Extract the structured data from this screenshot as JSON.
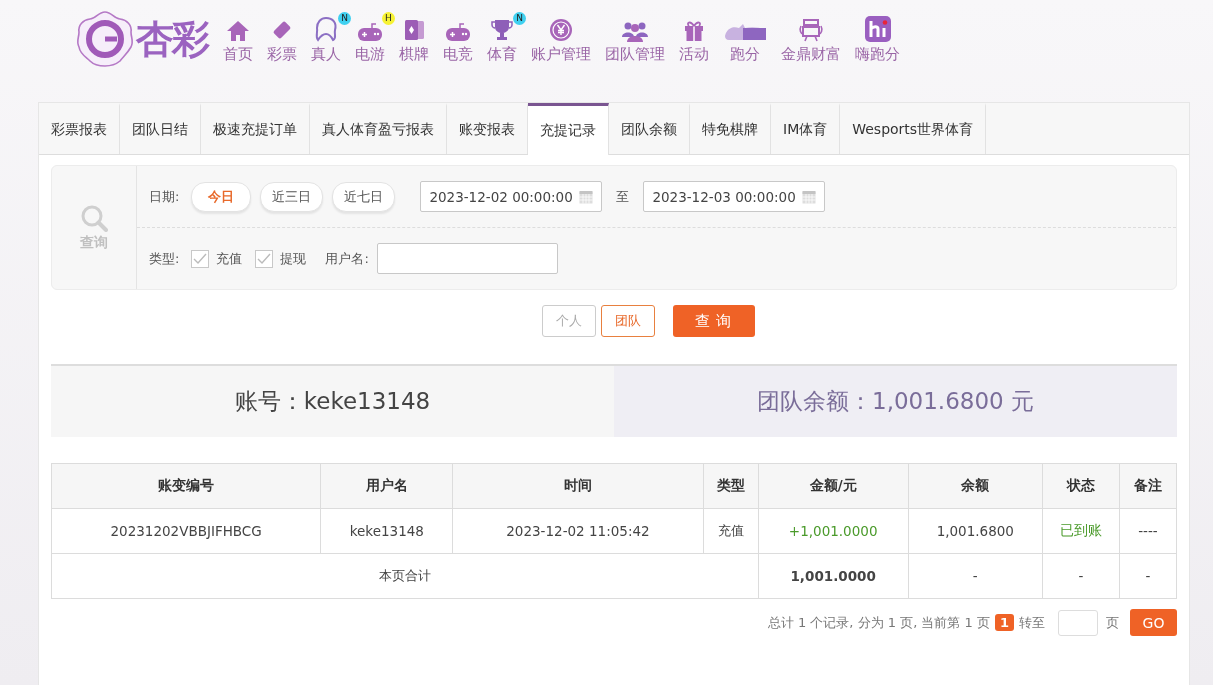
{
  "logo": {
    "text": "杏彩"
  },
  "nav": [
    {
      "label": "首页",
      "kind": "home"
    },
    {
      "label": "彩票",
      "kind": "ticket"
    },
    {
      "label": "真人",
      "kind": "person",
      "badge": "N"
    },
    {
      "label": "电游",
      "kind": "gamepad",
      "badge": "H"
    },
    {
      "label": "棋牌",
      "kind": "cards"
    },
    {
      "label": "电竞",
      "kind": "gamepad"
    },
    {
      "label": "体育",
      "kind": "trophy",
      "badge": "N"
    },
    {
      "label": "账户管理",
      "kind": "yen"
    },
    {
      "label": "团队管理",
      "kind": "group"
    },
    {
      "label": "活动",
      "kind": "gift"
    },
    {
      "label": "跑分",
      "kind": "rhino"
    },
    {
      "label": "金鼎财富",
      "kind": "jewel"
    },
    {
      "label": "嗨跑分",
      "kind": "hi"
    }
  ],
  "tabs": [
    {
      "label": "彩票报表",
      "selected": false
    },
    {
      "label": "团队日结",
      "selected": false
    },
    {
      "label": "极速充提订单",
      "selected": false
    },
    {
      "label": "真人体育盈亏报表",
      "selected": false
    },
    {
      "label": "账变报表",
      "selected": false
    },
    {
      "label": "充提记录",
      "selected": true
    },
    {
      "label": "团队余额",
      "selected": false
    },
    {
      "label": "特免棋牌",
      "selected": false
    },
    {
      "label": "IM体育",
      "selected": false
    },
    {
      "label": "Wesports世界体育",
      "selected": false
    }
  ],
  "filter": {
    "search_label": "查询",
    "date_label": "日期:",
    "quick_dates": [
      {
        "label": "今日",
        "selected": true
      },
      {
        "label": "近三日",
        "selected": false
      },
      {
        "label": "近七日",
        "selected": false
      }
    ],
    "date_from": "2023-12-02 00:00:00",
    "date_sep": "至",
    "date_to": "2023-12-03 00:00:00",
    "type_label": "类型:",
    "types": [
      {
        "label": "充值",
        "checked": true
      },
      {
        "label": "提现",
        "checked": true
      }
    ],
    "username_label": "用户名:"
  },
  "scope": [
    {
      "label": "个人",
      "selected": false
    },
    {
      "label": "团队",
      "selected": true
    }
  ],
  "query_button": "查 询",
  "summary": {
    "account": "账号：keke13148",
    "balance": "团队余额：1,001.6800 元"
  },
  "table": {
    "columns": [
      "账变编号",
      "用户名",
      "时间",
      "类型",
      "金额/元",
      "余额",
      "状态",
      "备注"
    ],
    "rows": [
      [
        "20231202VBBJIFHBCG",
        "keke13148",
        "2023-12-02 11:05:42",
        "充值",
        "+1,001.0000",
        "1,001.6800",
        "已到账",
        "----"
      ]
    ],
    "total": {
      "label": "本页合计",
      "amount": "1,001.0000",
      "cells": [
        "-",
        "-",
        "-"
      ]
    }
  },
  "pagination": {
    "info": "总计 1 个记录, 分为 1 页, 当前第 1 页",
    "current": "1",
    "goto_label": "转至",
    "page_unit": "页",
    "go": "GO"
  }
}
